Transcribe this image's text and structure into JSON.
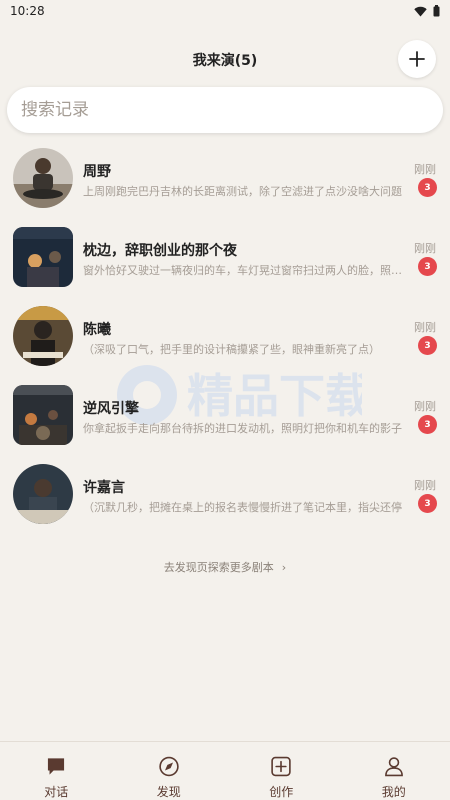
{
  "status_bar": {
    "time": "10:28"
  },
  "header": {
    "title": "我来演(5)"
  },
  "search": {
    "placeholder": "搜索记录"
  },
  "conversations": [
    {
      "name": "周野",
      "preview": "上周刚跑完巴丹吉林的长距离测试，除了空滤进了点沙没啥大问题",
      "time": "刚刚",
      "badge": "3"
    },
    {
      "name": "枕边，辞职创业的那个夜",
      "preview": "窗外恰好又驶过一辆夜归的车，车灯晃过窗帘扫过两人的脸，照亮了",
      "time": "刚刚",
      "badge": "3"
    },
    {
      "name": "陈曦",
      "preview": "（深吸了口气，把手里的设计稿攥紧了些，眼神重新亮了点）",
      "time": "刚刚",
      "badge": "3"
    },
    {
      "name": "逆风引擎",
      "preview": "你拿起扳手走向那台待拆的进口发动机，照明灯把你和机车的影子",
      "time": "刚刚",
      "badge": "3"
    },
    {
      "name": "许嘉言",
      "preview": "（沉默几秒，把摊在桌上的报名表慢慢折进了笔记本里，指尖还停",
      "time": "刚刚",
      "badge": "3"
    }
  ],
  "explore_link": "去发现页探索更多剧本",
  "watermark": "精品下载",
  "bottom_nav": [
    {
      "label": "对话",
      "icon": "chat-icon"
    },
    {
      "label": "发现",
      "icon": "compass-icon"
    },
    {
      "label": "创作",
      "icon": "plus-square-icon"
    },
    {
      "label": "我的",
      "icon": "person-icon"
    }
  ],
  "colors": {
    "accent": "#5a3a30",
    "badge": "#e5484d",
    "background": "#f4f1ec"
  }
}
